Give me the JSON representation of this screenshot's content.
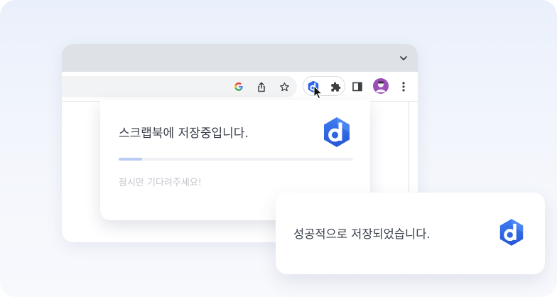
{
  "saving_card": {
    "title": "스크랩북에 저장중입니다.",
    "subtitle": "잠시만 기다려주세요!",
    "progress": 0.1
  },
  "success_card": {
    "title": "성공적으로 저장되었습니다."
  },
  "browser": {
    "toolbar_icons": [
      "google-icon",
      "share-icon",
      "bookmark-star-icon",
      "extension-d-icon",
      "puzzle-icon",
      "side-panel-icon",
      "profile-avatar",
      "kebab-menu-icon"
    ],
    "tab_strip_icon": "chevron-down-icon"
  },
  "colors": {
    "brand_blue": "#2f67e8",
    "brand_blue_dark": "#1f4fc4",
    "progress_fill": "#b9cdf4",
    "progress_track": "#eff1f5",
    "title_text": "#3a3f4a",
    "subtitle_text": "#c3c6cc",
    "avatar_purple": "#9c4fb8"
  }
}
